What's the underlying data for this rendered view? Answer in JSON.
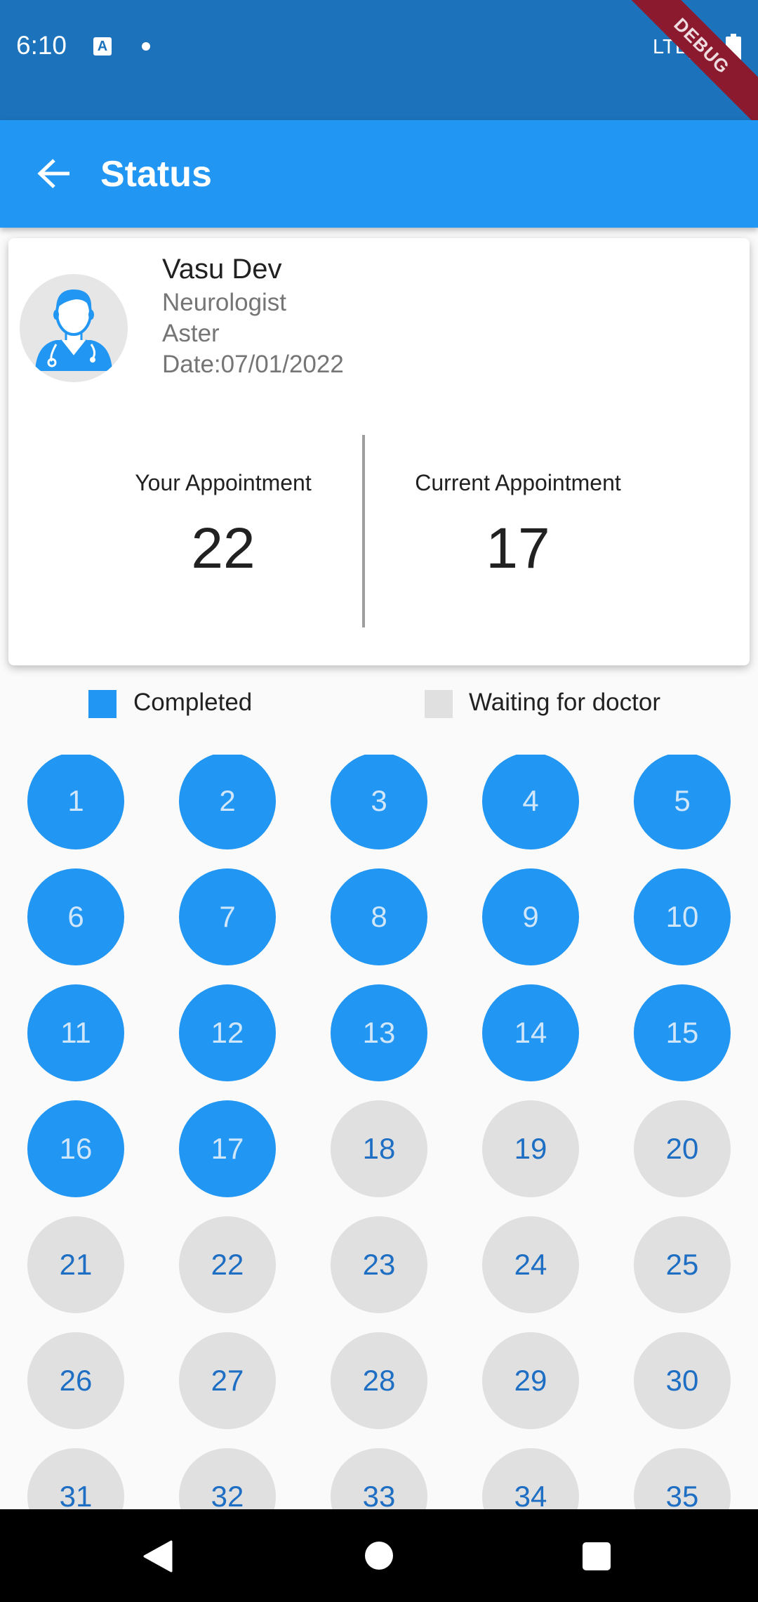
{
  "status_bar": {
    "time": "6:10",
    "network": "LTE",
    "debug_label": "DEBUG",
    "app_icon": "A",
    "icons": [
      "a-icon",
      "dot-icon",
      "signal-icon",
      "battery-icon"
    ]
  },
  "app_bar": {
    "title": "Status",
    "back_icon": "arrow-back-icon"
  },
  "doctor": {
    "name": "Vasu Dev",
    "specialty": "Neurologist",
    "hospital": "Aster",
    "date": "Date:07/01/2022"
  },
  "appointment": {
    "your_label": "Your Appointment",
    "your_number": "22",
    "current_label": "Current Appointment",
    "current_number": "17"
  },
  "legend": {
    "completed": "Completed",
    "waiting": "Waiting for doctor"
  },
  "colors": {
    "status_bar": "#1c72bb",
    "app_bar": "#2196f3",
    "completed": "#2196f3",
    "waiting": "#e0e0e0",
    "waiting_text": "#1e6fc4"
  },
  "tokens": {
    "completed_up_to": 17,
    "items": [
      "1",
      "2",
      "3",
      "4",
      "5",
      "6",
      "7",
      "8",
      "9",
      "10",
      "11",
      "12",
      "13",
      "14",
      "15",
      "16",
      "17",
      "18",
      "19",
      "20",
      "21",
      "22",
      "23",
      "24",
      "25",
      "26",
      "27",
      "28",
      "29",
      "30",
      "31",
      "32",
      "33",
      "34",
      "35"
    ]
  },
  "nav_bar": {
    "icons": [
      "nav-back-icon",
      "nav-home-icon",
      "nav-recents-icon"
    ]
  }
}
